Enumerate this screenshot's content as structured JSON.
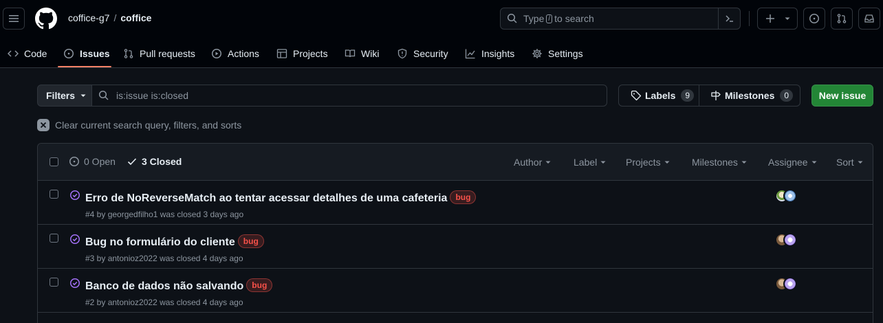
{
  "header": {
    "owner": "coffice-g7",
    "separator": "/",
    "repo": "coffice",
    "search_pre": "Type",
    "search_key": "/",
    "search_post": "to search"
  },
  "tabs": [
    {
      "label": "Code",
      "icon": "code-icon"
    },
    {
      "label": "Issues",
      "icon": "issue-opened-icon",
      "active": true
    },
    {
      "label": "Pull requests",
      "icon": "git-pull-request-icon"
    },
    {
      "label": "Actions",
      "icon": "play-icon"
    },
    {
      "label": "Projects",
      "icon": "table-icon"
    },
    {
      "label": "Wiki",
      "icon": "book-icon"
    },
    {
      "label": "Security",
      "icon": "shield-icon"
    },
    {
      "label": "Insights",
      "icon": "graph-icon"
    },
    {
      "label": "Settings",
      "icon": "gear-icon"
    }
  ],
  "toolbar": {
    "filters_label": "Filters",
    "search_value": "is:issue is:closed",
    "labels_label": "Labels",
    "labels_count": "9",
    "milestones_label": "Milestones",
    "milestones_count": "0",
    "new_issue_label": "New issue",
    "clear_label": "Clear current search query, filters, and sorts"
  },
  "list_header": {
    "open_label": "0 Open",
    "closed_label": "3 Closed",
    "filters": [
      "Author",
      "Label",
      "Projects",
      "Milestones",
      "Assignee",
      "Sort"
    ]
  },
  "issues": [
    {
      "title": "Erro de NoReverseMatch ao tentar acessar detalhes de uma cafeteria",
      "label": "bug",
      "meta": "#4 by georgedfilho1 was closed 3 days ago"
    },
    {
      "title": "Bug no formulário do cliente",
      "label": "bug",
      "meta": "#3 by antonioz2022 was closed 4 days ago"
    },
    {
      "title": "Banco de dados não salvando",
      "label": "bug",
      "meta": "#2 by antonioz2022 was closed 4 days ago"
    }
  ],
  "colors": {
    "background": "#0d1117",
    "header_bg": "#010409",
    "accent_underline": "#f78166",
    "new_issue_green": "#238636",
    "closed_purple": "#a371f7",
    "bug_label": "#f85149"
  }
}
